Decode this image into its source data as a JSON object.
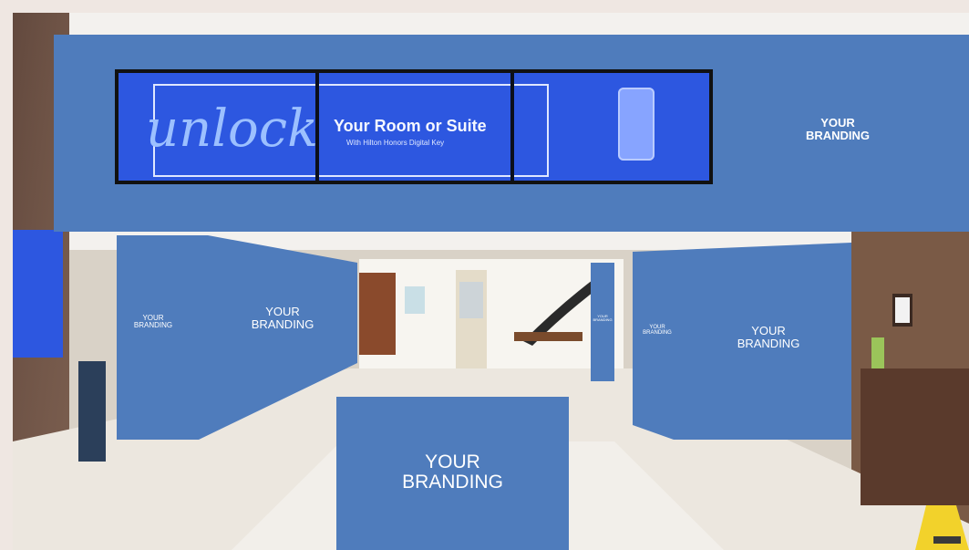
{
  "scene": {
    "colors": {
      "branding_blue": "#4f7cbc",
      "screen_blue": "#2d57e0",
      "wall_wood": "#6e5447",
      "floor": "#ece7df",
      "ceiling": "#f3f1ee"
    }
  },
  "digital_screen": {
    "script_word": "unlock",
    "headline": "Your Room or Suite",
    "subline": "With Hilton Honors Digital Key",
    "icon": "phone-icon"
  },
  "branding": {
    "top_banner": "YOUR\nBRANDING",
    "left_panel_small": "YOUR\nBRANDING",
    "left_panel_main": "YOUR\nBRANDING",
    "center_floor": "YOUR\nBRANDING",
    "right_panel_tiny": "YOUR\nBRANDING",
    "right_panel_small": "YOUR\nBRANDING",
    "right_panel_main": "YOUR\nBRANDING"
  }
}
